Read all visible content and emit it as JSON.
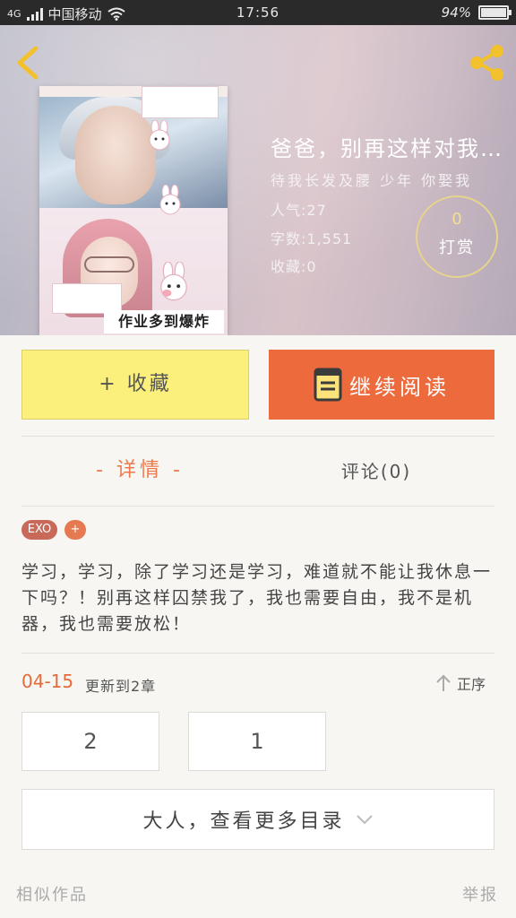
{
  "status_bar": {
    "network": "4G",
    "carrier": "中国移动",
    "time": "17:56",
    "battery": "94%",
    "battery_level": 0.94
  },
  "book": {
    "cover_caption": "作业多到爆炸",
    "title": "爸爸，别再这样对我…",
    "subtitle": "待我长发及腰 少年 你娶我",
    "popularity": "人气:27",
    "word_count": "字数:1,551",
    "favorites": "收藏:0"
  },
  "tip": {
    "count": "0",
    "label": "打赏"
  },
  "actions": {
    "favorite_label": "+ 收藏",
    "read_label": "继续阅读"
  },
  "tabs": {
    "detail": "- 详情 -",
    "comments": "评论(0)"
  },
  "tags": [
    "EXO",
    "+"
  ],
  "description": "学习，学习，除了学习还是学习，难道就不能让我休息一下吗？！别再这样囚禁我了，我也需要自由，我不是机器，我也需要放松！",
  "update": {
    "date": "04-15",
    "text": "更新到2章",
    "order_label": "正序"
  },
  "chapters": [
    "2",
    "1"
  ],
  "more_catalog": "大人，查看更多目录",
  "footer": {
    "similar": "相似作品",
    "report": "举报"
  },
  "colors": {
    "accent": "#ec6a3c",
    "favorite_bg": "#fbf07b",
    "tip_ring": "#e6d38c"
  }
}
